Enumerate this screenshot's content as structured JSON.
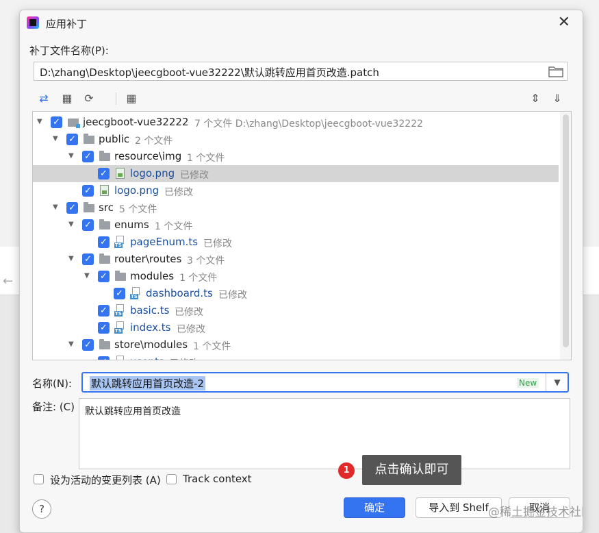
{
  "dialog": {
    "title": "应用补丁",
    "patch_label": "补丁文件名称(P):",
    "patch_path": "D:\\zhang\\Desktop\\jeecgboot-vue32222\\默认跳转应用首页改造.patch"
  },
  "toolbar": {
    "icons": [
      "show-diff-icon",
      "move-to-changelist-icon",
      "refresh-icon",
      "group-by-icon",
      "expand-all-icon",
      "collapse-all-icon"
    ]
  },
  "tree": {
    "rows": [
      {
        "name": "jeecgboot-vue32222",
        "meta": "7 个文件  D:\\zhang\\Desktop\\jeecgboot-vue32222",
        "kind": "project",
        "level": 0,
        "expanded": true
      },
      {
        "name": "public",
        "meta": "2 个文件",
        "kind": "folder",
        "level": 1,
        "expanded": true
      },
      {
        "name": "resource\\img",
        "meta": "1 个文件",
        "kind": "folder",
        "level": 2,
        "expanded": true
      },
      {
        "name": "logo.png",
        "meta": "已修改",
        "kind": "png",
        "level": 3,
        "selected": true
      },
      {
        "name": "logo.png",
        "meta": "已修改",
        "kind": "png",
        "level": 2
      },
      {
        "name": "src",
        "meta": "5 个文件",
        "kind": "folder",
        "level": 1,
        "expanded": true
      },
      {
        "name": "enums",
        "meta": "1 个文件",
        "kind": "folder",
        "level": 2,
        "expanded": true
      },
      {
        "name": "pageEnum.ts",
        "meta": "已修改",
        "kind": "ts",
        "level": 3
      },
      {
        "name": "router\\routes",
        "meta": "3 个文件",
        "kind": "folder",
        "level": 2,
        "expanded": true
      },
      {
        "name": "modules",
        "meta": "1 个文件",
        "kind": "folder",
        "level": 3,
        "expanded": true
      },
      {
        "name": "dashboard.ts",
        "meta": "已修改",
        "kind": "ts",
        "level": 4
      },
      {
        "name": "basic.ts",
        "meta": "已修改",
        "kind": "ts",
        "level": 3
      },
      {
        "name": "index.ts",
        "meta": "已修改",
        "kind": "ts",
        "level": 3
      },
      {
        "name": "store\\modules",
        "meta": "1 个文件",
        "kind": "folder",
        "level": 2,
        "expanded": true
      },
      {
        "name": "user.ts",
        "meta": "已修改",
        "kind": "ts",
        "level": 3
      }
    ]
  },
  "form": {
    "name_label": "名称(N):",
    "name_value": "默认跳转应用首页改造-2",
    "new_badge": "New",
    "note_label": "备注: (C)",
    "note_value": "默认跳转应用首页改造",
    "active_list_label": "设为活动的变更列表 (A)",
    "track_context_label": "Track context"
  },
  "annotation": {
    "badge": "1",
    "text": "点击确认即可"
  },
  "buttons": {
    "ok": "确定",
    "import_shelf": "导入到 Shelf",
    "cancel": "取消",
    "help": "?"
  },
  "watermark": "@稀土掘金技术社区",
  "colors": {
    "accent": "#3574f0",
    "selected_row": "#d5d5d5",
    "file_name": "#1a4fa0",
    "meta_text": "#888888",
    "tooltip_bg": "#555555",
    "badge_red": "#e02a2a"
  }
}
